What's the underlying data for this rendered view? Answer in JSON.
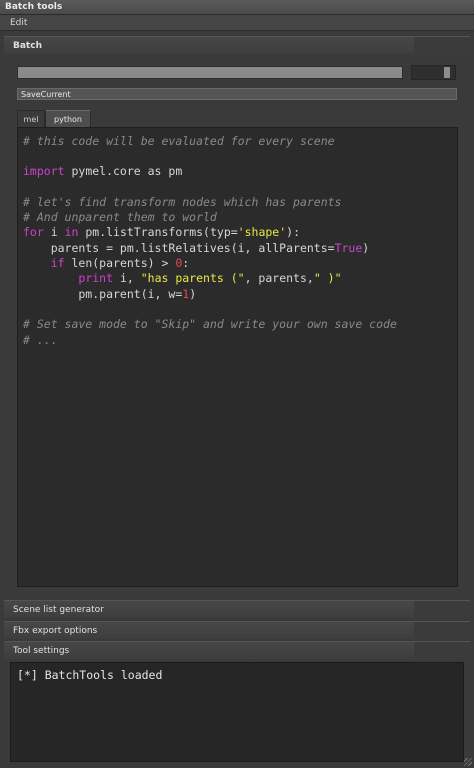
{
  "window": {
    "title": "Batch tools"
  },
  "menu": {
    "edit": "Edit"
  },
  "sections": {
    "batch": "Batch",
    "scene_list": "Scene list generator",
    "fbx": "Fbx export options",
    "tool_settings": "Tool settings"
  },
  "progress": {
    "value": 0
  },
  "save_button": "SaveCurrent",
  "tabs": [
    {
      "label": "mel"
    },
    {
      "label": "python"
    }
  ],
  "active_tab": "python",
  "code": {
    "l1": "# this code will be evaluated for every scene",
    "l3_kw": "import",
    "l3_rest": " pymel.core as pm",
    "l5": "# let's find transform nodes which has parents",
    "l6": "# And unparent them to world",
    "l7_kw1": "for",
    "l7_a": " i ",
    "l7_kw2": "in",
    "l7_b": " pm.listTransforms(typ=",
    "l7_str": "'shape'",
    "l7_c": "):",
    "l8_a": "    parents = pm.listRelatives(i, allParents=",
    "l8_true": "True",
    "l8_b": ")",
    "l9_sp": "    ",
    "l9_kw": "if",
    "l9_a": " len(parents) > ",
    "l9_num": "0",
    "l9_b": ":",
    "l10_sp": "        ",
    "l10_kw": "print",
    "l10_a": " i, ",
    "l10_s1": "\"has parents (\"",
    "l10_b": ", parents,",
    "l10_s2": "\" )\"",
    "l11_a": "        pm.parent(i, w=",
    "l11_num": "1",
    "l11_b": ")",
    "l13": "# Set save mode to \"Skip\" and write your own save code",
    "l14": "# ..."
  },
  "output": "[*] BatchTools loaded",
  "colors": {
    "comment": "#8a8a8a",
    "keyword": "#cc44cc",
    "string": "#e8e84a",
    "number": "#e8454a"
  }
}
